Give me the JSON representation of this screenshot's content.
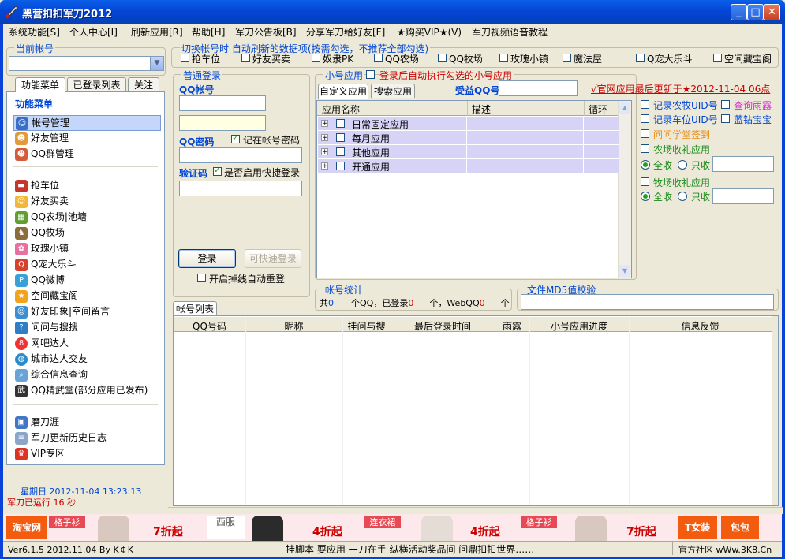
{
  "window": {
    "title": "黑营扣扣军刀2012"
  },
  "menu": [
    "系统功能[S]",
    "个人中心[I]",
    "刷新应用[R]",
    "帮助[H]",
    "军刀公告板[B]",
    "分享军刀给好友[F]",
    "★购买VIP★(V)",
    "军刀视频语音教程"
  ],
  "current_account": {
    "label": "当前帐号",
    "value": ""
  },
  "left_tabs": [
    "功能菜单",
    "已登录列表",
    "关注"
  ],
  "left_menu": {
    "heading": "功能菜单",
    "group1": [
      "帐号管理",
      "好友管理",
      "QQ群管理"
    ],
    "group2": [
      "抢车位",
      "好友买卖",
      "QQ农场|池塘",
      "QQ牧场",
      "玫瑰小镇",
      "Q宠大乐斗",
      "QQ微博",
      "空间藏宝阁",
      "好友印象|空间留言",
      "问问与搜搜",
      "网吧达人",
      "城市达人交友",
      "综合信息查询",
      "QQ精武堂(部分应用已发布)"
    ],
    "group3": [
      "磨刀涯",
      "军刀更新历史日志",
      "VIP专区"
    ],
    "date": "星期日 2012-11-04 13:23:13",
    "running": "军刀已运行 16 秒"
  },
  "refresh_group": {
    "label": "切换帐号时 自动刷新的数据项(按需勾选，不推荐全部勾选)",
    "items": [
      "抢车位",
      "好友买卖",
      "奴隶PK",
      "QQ农场",
      "QQ牧场",
      "玫瑰小镇",
      "魔法屋",
      "Q宠大乐斗",
      "空间藏宝阁"
    ]
  },
  "login": {
    "group_label": "普通登录",
    "qq_label": "QQ帐号",
    "pwd_label": "QQ密码",
    "remember": "记在帐号密码",
    "captcha_label": "验证码",
    "quick_enable": "是否启用快捷登录",
    "login_btn": "登录",
    "quick_btn": "可快速登录",
    "auto_reconnect": "开启掉线自动重登"
  },
  "small_apps": {
    "label": "小号应用",
    "auto_exec": "登录后自动执行勾选的小号应用",
    "tab_custom": "自定义应用",
    "tab_search": "搜索应用",
    "beneficiary_label": "受益QQ号",
    "official_note": "√官网应用最后更新于★2012-11-04 06点",
    "columns": [
      "应用名称",
      "描述",
      "循环"
    ],
    "rows": [
      "日常固定应用",
      "每月应用",
      "其他应用",
      "开通应用"
    ]
  },
  "right_options": {
    "record_farm": "记录农牧UID号",
    "query_rain": "查询雨露",
    "record_car": "记录车位UID号",
    "blue_diamond": "蓝钻宝宝",
    "wenwen_sign": "问问学堂签到",
    "farm_gift": "农场收礼应用",
    "all_collect": "全收",
    "only_collect": "只收",
    "ranch_gift": "牧场收礼应用"
  },
  "stats": {
    "label": "帐号统计",
    "text_total": "共",
    "total": "0",
    "text_qq": "个QQ，已登录",
    "logged": "0",
    "text_webqq": "个，WebQQ",
    "webqq": "0",
    "text_end": "个"
  },
  "md5": {
    "label": "文件MD5值校验",
    "value": ""
  },
  "account_list": {
    "tab": "帐号列表",
    "columns": [
      "QQ号码",
      "昵称",
      "挂问与搜",
      "最后登录时间",
      "雨露",
      "小号应用进度",
      "信息反馈"
    ]
  },
  "banner": {
    "items": [
      "淘宝网",
      "格子衫",
      "7折起",
      "西服",
      "4折起",
      "连衣裙",
      "4折起",
      "格子衫",
      "7折起",
      "T女装",
      "包包"
    ]
  },
  "status": {
    "version": "Ver6.1.5 2012.11.04  By K￠K",
    "slogan": "挂脚本 耍应用 一刀在手 纵横活动奖品间  问鼎扣扣世界……",
    "community": "官方社区  wWw.3K8.Cn"
  },
  "colors": {
    "accent_blue": "#0046d5",
    "link_red": "#cc0000",
    "row_purple": "#d7d3f6",
    "title_blue": "#0842d8"
  }
}
